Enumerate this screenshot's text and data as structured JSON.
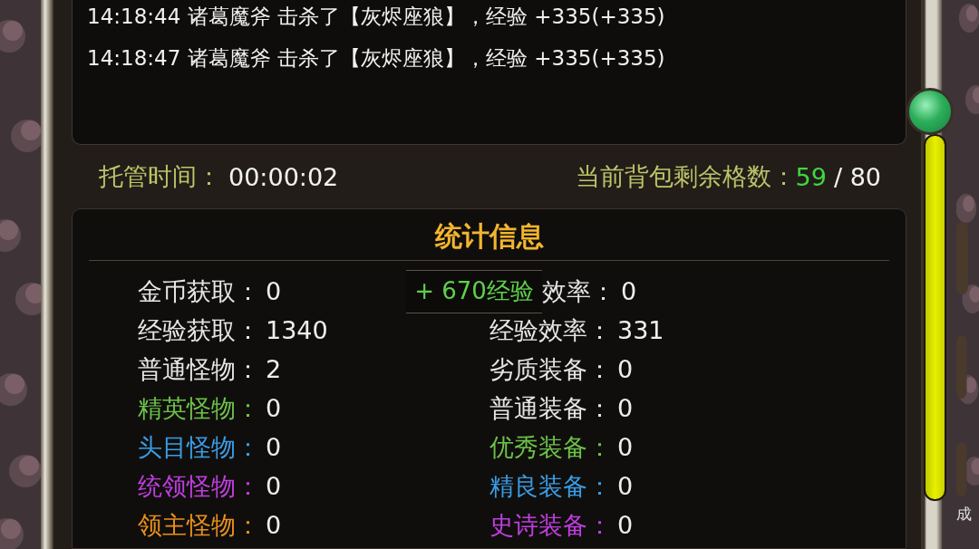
{
  "log": [
    {
      "text": "14:18:44 诸葛魔斧 击杀了【灰烬座狼】，经验 +335(+335)"
    },
    {
      "text": "14:18:47 诸葛魔斧 击杀了【灰烬座狼】，经验 +335(+335)"
    }
  ],
  "auto_time": {
    "label": "托管时间：",
    "value": "00:00:02"
  },
  "bag": {
    "label": "当前背包剩余格数：",
    "free": "59",
    "total": "/ 80"
  },
  "stats": {
    "title": "统计信息",
    "columns": [
      [
        {
          "label": "金币获取：",
          "value": "0",
          "color": "#e6e6e6"
        },
        {
          "label": "经验获取：",
          "value": "1340",
          "color": "#e6e6e6"
        },
        {
          "label": "普通怪物：",
          "value": "2",
          "color": "#e6e6e6"
        },
        {
          "label": "精英怪物：",
          "value": "0",
          "color": "#6cc24a"
        },
        {
          "label": "头目怪物：",
          "value": "0",
          "color": "#3a9de6"
        },
        {
          "label": "统领怪物：",
          "value": "0",
          "color": "#c03ee0"
        },
        {
          "label": "领主怪物：",
          "value": "0",
          "color": "#e8901c"
        }
      ],
      [
        {
          "label": "效率：",
          "value": "0",
          "color": "#e6e6e6",
          "toast": "+ 670经验"
        },
        {
          "label": "经验效率：",
          "value": "331",
          "color": "#e6e6e6"
        },
        {
          "label": "劣质装备：",
          "value": "0",
          "color": "#e6e6e6"
        },
        {
          "label": "普通装备：",
          "value": "0",
          "color": "#e6e6e6"
        },
        {
          "label": "优秀装备：",
          "value": "0",
          "color": "#6cc24a"
        },
        {
          "label": "精良装备：",
          "value": "0",
          "color": "#3a9de6"
        },
        {
          "label": "史诗装备：",
          "value": "0",
          "color": "#c03ee0"
        }
      ]
    ]
  },
  "edge_label": "成"
}
